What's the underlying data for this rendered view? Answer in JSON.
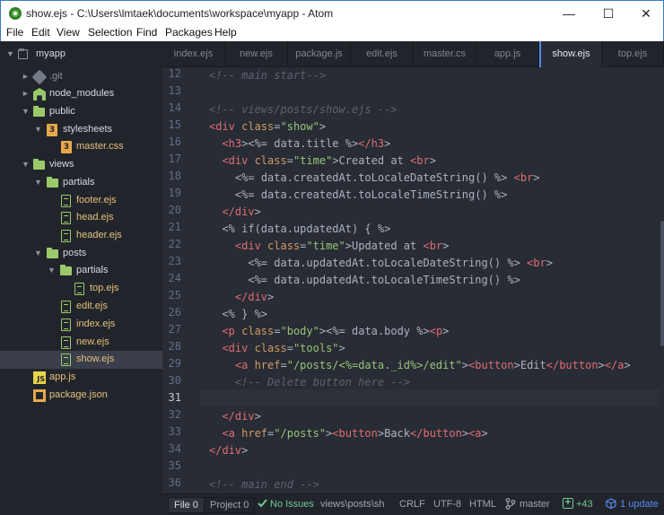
{
  "window": {
    "title": "show.ejs - C:\\Users\\lmtaek\\documents\\workspace\\myapp - Atom",
    "minimize": "—",
    "maximize": "☐",
    "close": "✕"
  },
  "menu": [
    "File",
    "Edit",
    "View",
    "Selection",
    "Find",
    "Packages",
    "Help"
  ],
  "tree": {
    "root": "myapp",
    "items": [
      {
        "label": ".git",
        "type": "folder",
        "expanded": false
      },
      {
        "label": "node_modules",
        "type": "folder",
        "expanded": false
      },
      {
        "label": "public",
        "type": "folder",
        "expanded": true
      },
      {
        "label": "stylesheets",
        "type": "folder",
        "expanded": true
      },
      {
        "label": "master.css",
        "type": "file"
      },
      {
        "label": "views",
        "type": "folder",
        "expanded": true
      },
      {
        "label": "partials",
        "type": "folder",
        "expanded": true
      },
      {
        "label": "footer.ejs",
        "type": "file"
      },
      {
        "label": "head.ejs",
        "type": "file"
      },
      {
        "label": "header.ejs",
        "type": "file"
      },
      {
        "label": "posts",
        "type": "folder",
        "expanded": true
      },
      {
        "label": "partials",
        "type": "folder",
        "expanded": true
      },
      {
        "label": "top.ejs",
        "type": "file"
      },
      {
        "label": "edit.ejs",
        "type": "file"
      },
      {
        "label": "index.ejs",
        "type": "file"
      },
      {
        "label": "new.ejs",
        "type": "file"
      },
      {
        "label": "show.ejs",
        "type": "file",
        "selected": true
      },
      {
        "label": "app.js",
        "type": "file"
      },
      {
        "label": "package.json",
        "type": "file"
      }
    ]
  },
  "tabs": [
    "index.ejs",
    "new.ejs",
    "package.js",
    "edit.ejs",
    "master.cs",
    "app.js",
    "show.ejs",
    "top.ejs"
  ],
  "active_tab": "show.ejs",
  "editor": {
    "current_line": 31,
    "lines": [
      {
        "n": "12",
        "text": "<!-- main start-->"
      },
      {
        "n": "13",
        "text": ""
      },
      {
        "n": "14",
        "text": "<!-- views/posts/show.ejs -->"
      },
      {
        "n": "15",
        "text": "<div class=\"show\">"
      },
      {
        "n": "16",
        "text": "  <h3><%= data.title %></h3>"
      },
      {
        "n": "17",
        "text": "  <div class=\"time\">Created at <br>"
      },
      {
        "n": "18",
        "text": "    <%= data.createdAt.toLocaleDateString() %> <br>"
      },
      {
        "n": "19",
        "text": "    <%= data.createdAt.toLocaleTimeString() %>"
      },
      {
        "n": "20",
        "text": "  </div>"
      },
      {
        "n": "21",
        "text": "  <% if(data.updatedAt) { %>"
      },
      {
        "n": "22",
        "text": "    <div class=\"time\">Updated at <br>"
      },
      {
        "n": "23",
        "text": "      <%= data.updatedAt.toLocaleDateString() %> <br>"
      },
      {
        "n": "24",
        "text": "      <%= data.updatedAt.toLocaleTimeString() %>"
      },
      {
        "n": "25",
        "text": "    </div>"
      },
      {
        "n": "26",
        "text": "  <% } %>"
      },
      {
        "n": "27",
        "text": "  <p class=\"body\"><%= data.body %><p>"
      },
      {
        "n": "28",
        "text": "  <div class=\"tools\">"
      },
      {
        "n": "29",
        "text": "    <a href=\"/posts/<%=data._id%>/edit\"><button>Edit</button></a>"
      },
      {
        "n": "30",
        "text": "    <!-- Delete button here -->"
      },
      {
        "n": "31",
        "text": ""
      },
      {
        "n": "32",
        "text": "  </div>"
      },
      {
        "n": "33",
        "text": "  <a href=\"/posts\"><button>Back</button><a>"
      },
      {
        "n": "34",
        "text": "</div>"
      },
      {
        "n": "35",
        "text": ""
      },
      {
        "n": "36",
        "text": "<!-- main end -->"
      }
    ]
  },
  "status": {
    "file": "File 0",
    "project": "Project 0",
    "issues": "No Issues",
    "path": "views\\posts\\sh",
    "line_ending": "CRLF",
    "encoding": "UTF-8",
    "grammar": "HTML",
    "branch": "master",
    "changes": "+43",
    "update": "1 update"
  },
  "colors": {
    "accent": "#568af2",
    "folder": "#9bc96a",
    "ok": "#73c990",
    "update": "#568af2"
  }
}
